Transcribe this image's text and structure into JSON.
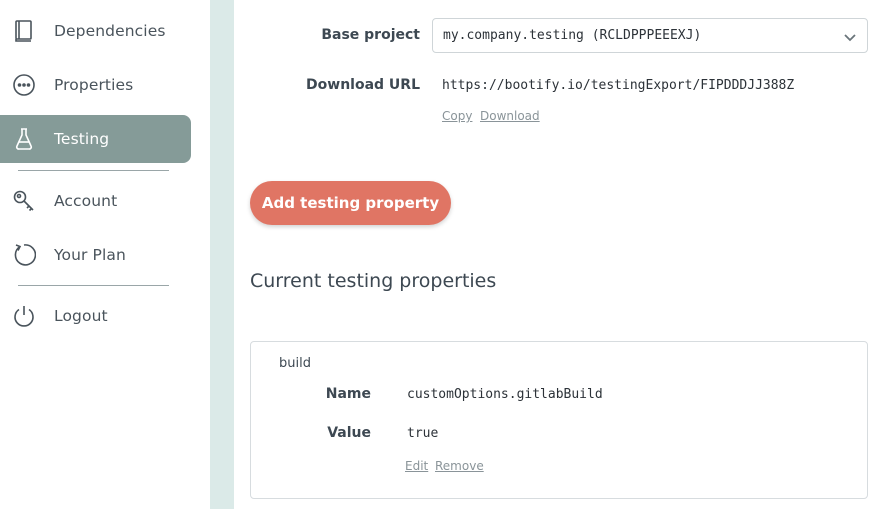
{
  "sidebar": {
    "items": [
      {
        "label": "Dependencies",
        "icon": "book-icon"
      },
      {
        "label": "Properties",
        "icon": "dots-circle-icon"
      },
      {
        "label": "Testing",
        "icon": "flask-icon",
        "active": true
      },
      {
        "label": "Account",
        "icon": "key-icon"
      },
      {
        "label": "Your Plan",
        "icon": "refresh-icon"
      },
      {
        "label": "Logout",
        "icon": "power-icon"
      }
    ]
  },
  "form": {
    "base_project_label": "Base project",
    "base_project_value": "my.company.testing (RCLDPPPEEEXJ)",
    "download_url_label": "Download URL",
    "download_url_value": "https://bootify.io/testingExport/FIPDDDJJ388Z",
    "copy_link": "Copy",
    "download_link": "Download"
  },
  "add_button_label": "Add testing property",
  "section_title": "Current testing properties",
  "properties": [
    {
      "group": "build",
      "name_label": "Name",
      "name": "customOptions.gitlabBuild",
      "value_label": "Value",
      "value": "true",
      "edit_link": "Edit",
      "remove_link": "Remove"
    }
  ],
  "colors": {
    "active_nav": "#859b98",
    "accent_button": "#e07564",
    "divider_strip": "#dbeae8"
  }
}
